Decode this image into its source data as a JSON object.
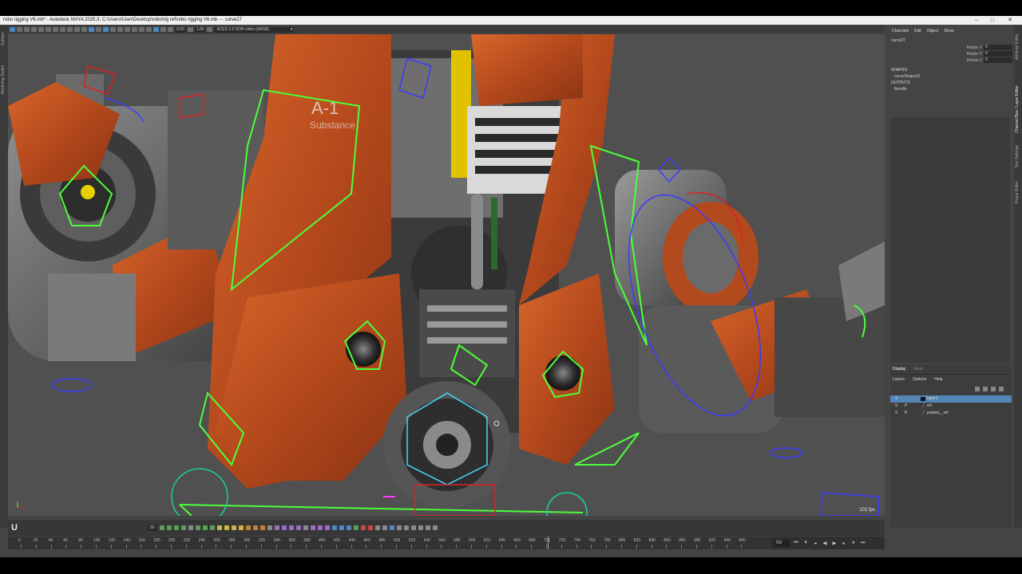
{
  "window": {
    "title": "robo rigging V6.mb* - Autodesk MAYA 2025.3: C:\\Users\\User\\Desktop\\robo\\rig ref\\robo rigging V6.mb   ---   curve27",
    "minimize_icon": "minimize-icon",
    "maximize_icon": "maximize-icon",
    "close_icon": "close-icon"
  },
  "toolbar": {
    "field_a": "0.00",
    "field_b": "1.00",
    "colorspace": "ACES 1.0 SDR-video (sRGB)"
  },
  "left_strip": {
    "outliner": "Outliner",
    "modeling_toolkit": "Modeling Toolkit"
  },
  "viewport": {
    "fps": "102 fps",
    "model_decal": "A-1",
    "model_decal2": "Substance"
  },
  "channel_box": {
    "menu": [
      "Channels",
      "Edit",
      "Object",
      "Show"
    ],
    "node_name": "curve27",
    "attributes": [
      {
        "label": "Rotate X",
        "value": "0"
      },
      {
        "label": "Rotate Y",
        "value": "0"
      },
      {
        "label": "Rotate Z",
        "value": "0"
      }
    ],
    "shapes_header": "SHAPES",
    "shape_item": "curveShape26",
    "outputs_header": "OUTPUTS",
    "output_item": "Bendlo"
  },
  "right_strip": {
    "attribute_editor": "Attribute Editor",
    "channel_box": "Channel Box / Layer Editor",
    "tool_settings": "Tool Settings",
    "shape_editor": "Shape Editor"
  },
  "layer_editor": {
    "tabs": [
      "Display",
      "Anim"
    ],
    "menu": [
      "Layers",
      "Options",
      "Help"
    ],
    "layers": [
      {
        "v": "V",
        "p": "",
        "name": "layer1",
        "selected": true
      },
      {
        "v": "V",
        "p": "P",
        "name": "ref",
        "selected": false
      },
      {
        "v": "V",
        "p": "P",
        "name": "pasted__ref",
        "selected": false
      }
    ]
  },
  "timeline": {
    "logo": "U",
    "step_field": "50",
    "ruler_ticks": [
      "0",
      "20",
      "40",
      "60",
      "80",
      "100",
      "120",
      "140",
      "160",
      "180",
      "200",
      "220",
      "240",
      "260",
      "280",
      "300",
      "320",
      "340",
      "360",
      "380",
      "400",
      "420",
      "440",
      "460",
      "480",
      "500",
      "520",
      "540",
      "560",
      "580",
      "600",
      "620",
      "640",
      "660",
      "680",
      "700",
      "720",
      "740",
      "760",
      "780",
      "800",
      "820",
      "840",
      "860",
      "880",
      "900",
      "920",
      "940",
      "960"
    ],
    "current_frame": "702",
    "current_frame_value": 702,
    "max_frame": 960
  },
  "colors": {
    "selection_blue": "#5385b6",
    "control_green": "#4cff3a",
    "control_blue": "#3b3bff",
    "control_red": "#e02020",
    "robot_orange": "#c4541f"
  }
}
